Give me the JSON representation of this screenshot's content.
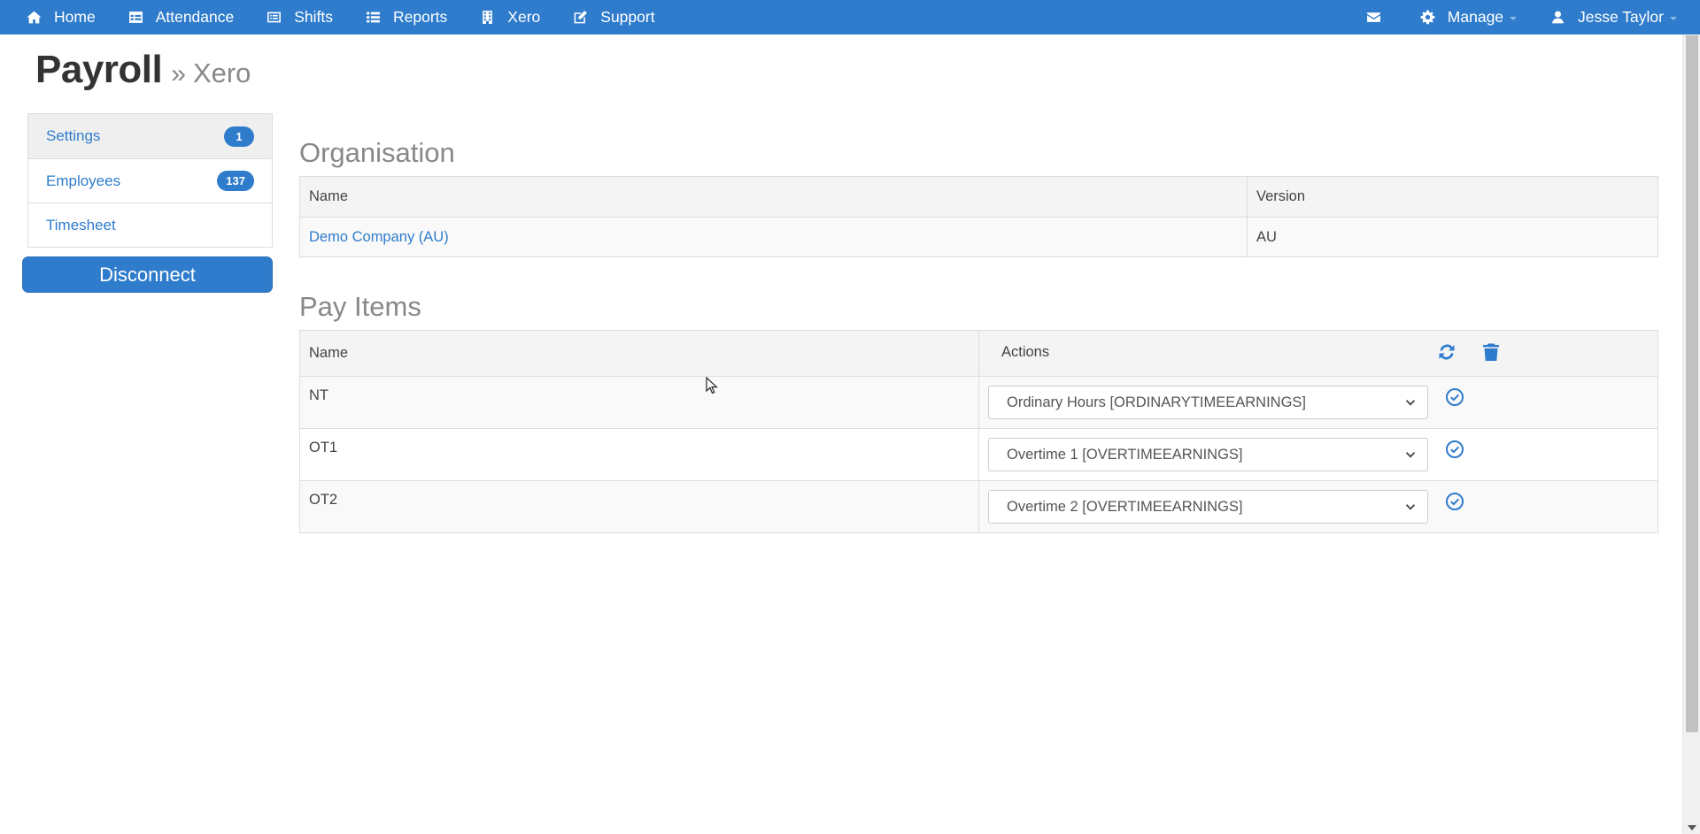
{
  "nav": {
    "items": [
      {
        "label": "Home",
        "icon": "home-icon"
      },
      {
        "label": "Attendance",
        "icon": "table-icon"
      },
      {
        "label": "Shifts",
        "icon": "list-alt-icon"
      },
      {
        "label": "Reports",
        "icon": "list-icon"
      },
      {
        "label": "Xero",
        "icon": "building-icon"
      },
      {
        "label": "Support",
        "icon": "edit-icon"
      }
    ],
    "right": {
      "mail_icon": "envelope-icon",
      "manage_label": "Manage",
      "user_label": "Jesse Taylor"
    }
  },
  "page": {
    "title": "Payroll",
    "separator": "»",
    "subtitle": "Xero"
  },
  "sidebar": {
    "items": [
      {
        "label": "Settings",
        "badge": "1"
      },
      {
        "label": "Employees",
        "badge": "137"
      },
      {
        "label": "Timesheet",
        "badge": null
      }
    ],
    "disconnect_label": "Disconnect"
  },
  "organisation": {
    "title": "Organisation",
    "headers": [
      "Name",
      "Version"
    ],
    "rows": [
      {
        "name": "Demo Company (AU)",
        "version": "AU"
      }
    ]
  },
  "pay_items": {
    "title": "Pay Items",
    "headers": [
      "Name",
      "Actions"
    ],
    "rows": [
      {
        "name": "NT",
        "selected": "Ordinary Hours [ORDINARYTIMEEARNINGS]"
      },
      {
        "name": "OT1",
        "selected": "Overtime 1 [OVERTIMEEARNINGS]"
      },
      {
        "name": "OT2",
        "selected": "Overtime 2 [OVERTIMEEARNINGS]"
      }
    ]
  },
  "colors": {
    "primary": "#2f7ccc",
    "muted_text": "#888888"
  }
}
